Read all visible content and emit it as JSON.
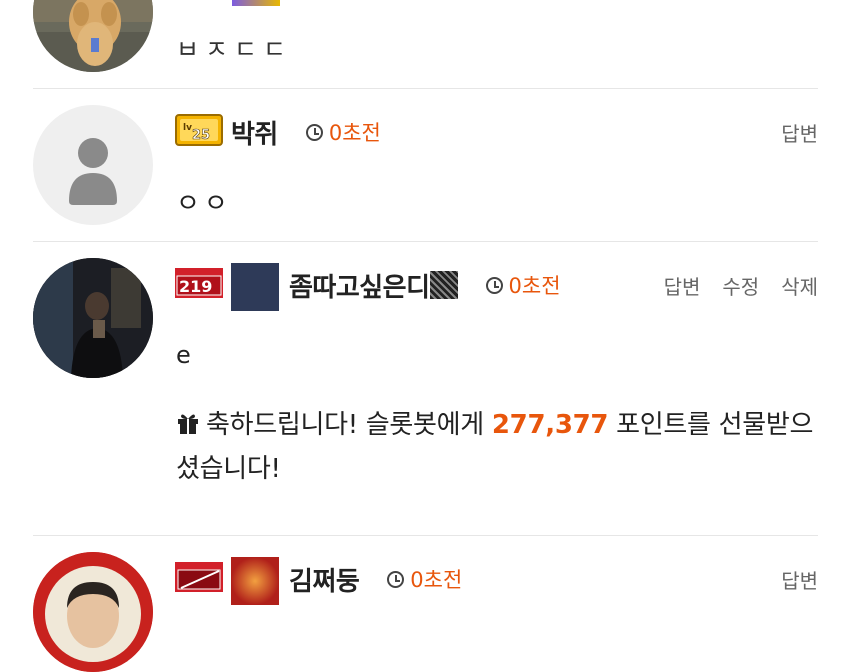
{
  "comments": [
    {
      "nickname": "",
      "time": "",
      "text": "ㅂㅈㄷㄷ",
      "actions": []
    },
    {
      "nickname": "박쥐",
      "level": "25",
      "time": "0초전",
      "text": "ㅇㅇ",
      "actions": [
        "답변"
      ]
    },
    {
      "nickname": "좀따고싶은디",
      "level": "219",
      "time": "0초전",
      "text": "e",
      "actions": [
        "답변",
        "수정",
        "삭제"
      ],
      "gift": {
        "prefix": "축하드립니다! 슬롯봇에게 ",
        "points": "277,377",
        "suffix": " 포인트를 선물받으셨습니다!"
      }
    },
    {
      "nickname": "김쩌둥",
      "time": "0초전",
      "text": "",
      "actions": [
        "답변"
      ]
    }
  ],
  "colors": {
    "accent": "#e8560c",
    "divider": "#e6e6e6",
    "level_gold": "#f4b300",
    "level_red": "#d2202a"
  }
}
